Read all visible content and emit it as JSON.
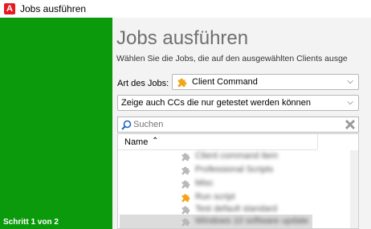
{
  "window": {
    "title": "Jobs ausführen",
    "app_icon_letter": "A"
  },
  "sidebar": {
    "step_label": "Schritt 1 von 2",
    "color": "#0b9a0b"
  },
  "main": {
    "heading": "Jobs ausführen",
    "subheading": "Wählen Sie die Jobs, die auf den ausgewählten Clients ausge",
    "job_type": {
      "label": "Art des Jobs:",
      "value": "Client Command",
      "icon": "puzzle-icon"
    },
    "filter": {
      "value": "Zeige auch CCs die nur getestet werden können"
    },
    "search": {
      "placeholder": "Suchen",
      "value": ""
    },
    "list": {
      "column_name": "Name",
      "items": [
        {
          "label": "Client command item",
          "icon": "puzzle-gray-icon",
          "blurred": true
        },
        {
          "label": "Professional Scripts",
          "icon": "puzzle-gray-icon",
          "blurred": true
        },
        {
          "label": "Misc",
          "icon": "puzzle-gray-icon",
          "blurred": true
        },
        {
          "label": "Run script",
          "icon": "puzzle-orange-icon",
          "blurred": true
        },
        {
          "label": "Test default standard",
          "icon": "puzzle-gray-icon",
          "blurred": true
        },
        {
          "label": "Windows 10 software update",
          "icon": "puzzle-gray-icon",
          "blurred": true
        }
      ]
    }
  }
}
